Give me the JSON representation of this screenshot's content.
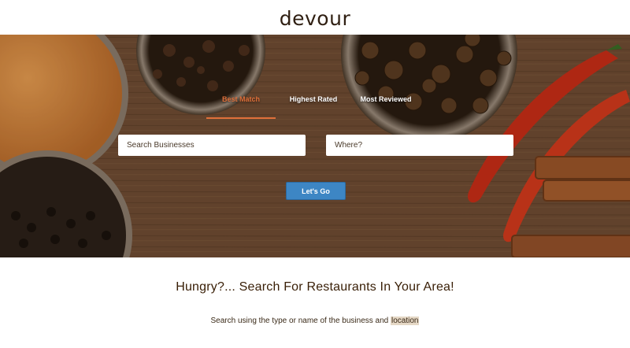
{
  "brand": {
    "name": "devour"
  },
  "hero": {
    "sort_tabs": [
      {
        "label": "Best Match",
        "active": true
      },
      {
        "label": "Highest Rated",
        "active": false
      },
      {
        "label": "Most Reviewed",
        "active": false
      }
    ],
    "search": {
      "term_placeholder": "Search Businesses",
      "location_placeholder": "Where?",
      "term_value": "",
      "location_value": ""
    },
    "submit_label": "Let's Go"
  },
  "content": {
    "tagline": "Hungry?... Search For Restaurants In Your Area!",
    "instructions_prefix": "Search using the type or name of the business and ",
    "instructions_highlight": "location"
  },
  "colors": {
    "active_tab": "#e0703a",
    "button": "#3d86c4",
    "text_dark": "#3a2008"
  }
}
